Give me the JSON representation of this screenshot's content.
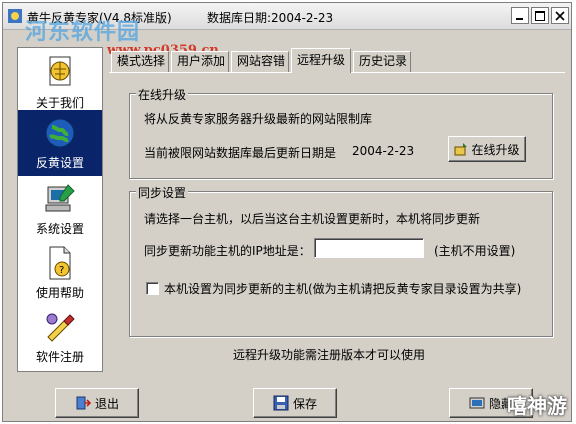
{
  "window": {
    "title": "黄牛反黄专家(V4.8标准版)",
    "db_date": "数据库日期:2004-2-23",
    "watermark": "河东软件园",
    "watermark_url": "www.pc0359.cn"
  },
  "sidebar": {
    "items": [
      {
        "label": "关于我们",
        "icon": "globe-doc-icon"
      },
      {
        "label": "反黄设置",
        "icon": "globe-icon"
      },
      {
        "label": "系统设置",
        "icon": "computer-settings-icon"
      },
      {
        "label": "使用帮助",
        "icon": "help-doc-icon"
      },
      {
        "label": "软件注册",
        "icon": "register-tools-icon"
      }
    ],
    "active_index": 1
  },
  "tabs": [
    "模式选择",
    "用户添加",
    "网站容错",
    "远程升级",
    "历史记录"
  ],
  "active_tab": 3,
  "online_upgrade": {
    "title": "在线升级",
    "description": "将从反黄专家服务器升级最新的网站限制库",
    "last_update_label": "当前被限网站数据库最后更新日期是",
    "last_update_date": "2004-2-23",
    "button_label": "在线升级"
  },
  "sync": {
    "title": "同步设置",
    "description": "请选择一台主机，以后当这台主机设置更新时，本机将同步更新",
    "ip_label": "同步更新功能主机的IP地址是：",
    "ip_value": "",
    "ip_hint": "(主机不用设置)",
    "checkbox_label": "本机设置为同步更新的主机(做为主机请把反黄专家目录设置为共享)",
    "checkbox_checked": false
  },
  "notice": "远程升级功能需注册版本才可以使用",
  "bottom_buttons": {
    "exit": "退出",
    "save": "保存",
    "hide": "隐藏"
  },
  "corner_watermark": "嘻神游"
}
